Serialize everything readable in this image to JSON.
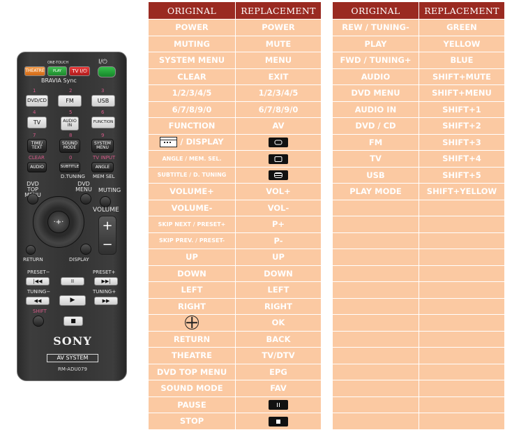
{
  "remote": {
    "theatre": "THEATRE",
    "one_touch_play": "ONE-TOUCH\nPLAY",
    "tv_power": "TV I/⏻",
    "power": "I/⏻",
    "bravia_sync": "BRAVIA Sync",
    "num1": "1",
    "num2": "2",
    "num3": "3",
    "dvd_cd": "DVD/CD",
    "fm": "FM",
    "usb": "USB",
    "num4": "4",
    "num5": "5",
    "num6": "6",
    "tv": "TV",
    "audio_in": "AUDIO IN",
    "function": "FUNCTION",
    "num7": "7",
    "num8": "8",
    "num9": "9",
    "time_text": "TIME/ TEXT",
    "sound_mode": "SOUND MODE",
    "system_menu": "SYSTEM MENU",
    "clear": "CLEAR",
    "num0": "0",
    "tv_input": "TV INPUT",
    "audio": "AUDIO",
    "subtitle": "SUBTITLE",
    "angle": "ANGLE",
    "d_tuning": "D.TUNING",
    "mem_sel": "MEM SEL",
    "dvd_top_menu": "DVD TOP MENU",
    "dvd_menu": "DVD MENU",
    "muting": "MUTING",
    "volume": "VOLUME",
    "vol_plus": "+",
    "vol_minus": "−",
    "return": "RETURN",
    "display": "DISPLAY",
    "preset_minus": "PRESET−",
    "preset_plus": "PRESET+",
    "tuning_minus": "TUNING−",
    "tuning_plus": "TUNING+",
    "shift": "SHIFT",
    "brand": "SONY",
    "av_system": "AV SYSTEM",
    "model": "RM-ADU079"
  },
  "tables": {
    "header_original": "ORIGINAL",
    "header_replacement": "REPLACEMENT",
    "left_rows": [
      {
        "original": "POWER",
        "replacement": "POWER"
      },
      {
        "original": "MUTING",
        "replacement": "MUTE"
      },
      {
        "original": "SYSTEM MENU",
        "replacement": "MENU"
      },
      {
        "original": "CLEAR",
        "replacement": "EXIT"
      },
      {
        "original": "1/2/3/4/5",
        "replacement": "1/2/3/4/5"
      },
      {
        "original": "6/7/8/9/0",
        "replacement": "6/7/8/9/0"
      },
      {
        "original": "FUNCTION",
        "replacement": "AV"
      },
      {
        "original": "/ DISPLAY",
        "original_icon": "display-icon",
        "replacement": "",
        "replacement_icon": "rounded-rect-icon"
      },
      {
        "original": "ANGLE / MEM. SEL.",
        "replacement": "",
        "replacement_icon": "angle-icon"
      },
      {
        "original": "SUBTITLE / D. TUNING",
        "replacement": "",
        "replacement_icon": "subtitle-icon"
      },
      {
        "original": "VOLUME+",
        "replacement": "VOL+"
      },
      {
        "original": "VOLUME-",
        "replacement": "VOL-"
      },
      {
        "original": "SKIP NEXT / PRESET+",
        "replacement": "P+"
      },
      {
        "original": "SKIP PREV. / PRESET-",
        "replacement": "P-"
      },
      {
        "original": "UP",
        "replacement": "UP"
      },
      {
        "original": "DOWN",
        "replacement": "DOWN"
      },
      {
        "original": "LEFT",
        "replacement": "LEFT"
      },
      {
        "original": "RIGHT",
        "replacement": "RIGHT"
      },
      {
        "original": "",
        "original_icon": "crosshair-icon",
        "replacement": "OK"
      },
      {
        "original": "RETURN",
        "replacement": "BACK"
      },
      {
        "original": "THEATRE",
        "replacement": "TV/DTV"
      },
      {
        "original": "DVD TOP MENU",
        "replacement": "EPG"
      },
      {
        "original": "SOUND MODE",
        "replacement": "FAV"
      },
      {
        "original": "PAUSE",
        "replacement": "",
        "replacement_icon": "pause-icon"
      },
      {
        "original": "STOP",
        "replacement": "",
        "replacement_icon": "stop-icon"
      }
    ],
    "right_rows": [
      {
        "original": "REW / TUNING-",
        "replacement": "GREEN"
      },
      {
        "original": "PLAY",
        "replacement": "YELLOW"
      },
      {
        "original": "FWD / TUNING+",
        "replacement": "BLUE"
      },
      {
        "original": "AUDIO",
        "replacement": "SHIFT+MUTE"
      },
      {
        "original": "DVD MENU",
        "replacement": "SHIFT+MENU"
      },
      {
        "original": "AUDIO IN",
        "replacement": "SHIFT+1"
      },
      {
        "original": "DVD / CD",
        "replacement": "SHIFT+2"
      },
      {
        "original": "FM",
        "replacement": "SHIFT+3"
      },
      {
        "original": "TV",
        "replacement": "SHIFT+4"
      },
      {
        "original": "USB",
        "replacement": "SHIFT+5"
      },
      {
        "original": "PLAY MODE",
        "replacement": "SHIFT+YELLOW"
      }
    ],
    "right_empty_rows": 14
  },
  "colors": {
    "header_bg": "#9a2a21",
    "cell_bg": "#fbc9a2",
    "text": "#ffffff"
  }
}
